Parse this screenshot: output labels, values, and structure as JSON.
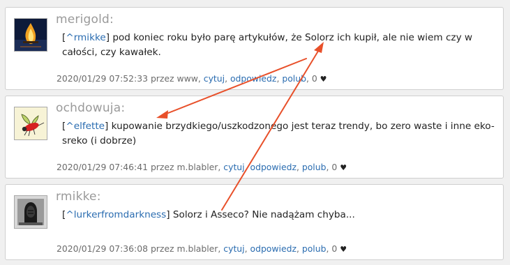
{
  "comments": [
    {
      "author": "merigold:",
      "mention": "^rmikke",
      "text": " pod koniec roku było parę artykułów, że Solorz ich kupił, ale nie wiem czy w całości, czy kawałek.",
      "meta_prefix": "2020/01/29 07:52:33 przez www,",
      "cite": "cytuj",
      "reply": "odpowiedz",
      "like": "polub",
      "likes": "0"
    },
    {
      "author": "ochdowuja:",
      "mention": "^elfette",
      "text": " kupowanie brzydkiego/uszkodzonego jest teraz trendy, bo zero waste i inne eko-sreko (i dobrze)",
      "meta_prefix": "2020/01/29 07:46:41 przez m.blabler,",
      "cite": "cytuj",
      "reply": "odpowiedz",
      "like": "polub",
      "likes": "0"
    },
    {
      "author": "rmikke:",
      "mention": "^lurkerfromdarkness",
      "text": " Solorz i Asseco? Nie nadążam chyba...",
      "meta_prefix": "2020/01/29 07:36:08 przez m.blabler,",
      "cite": "cytuj",
      "reply": "odpowiedz",
      "like": "polub",
      "likes": "0"
    }
  ],
  "colors": {
    "link": "#2a6cb0",
    "author": "#9a9a9a",
    "arrow": "#e8502a"
  },
  "icons": {
    "heart": "heart-icon"
  }
}
